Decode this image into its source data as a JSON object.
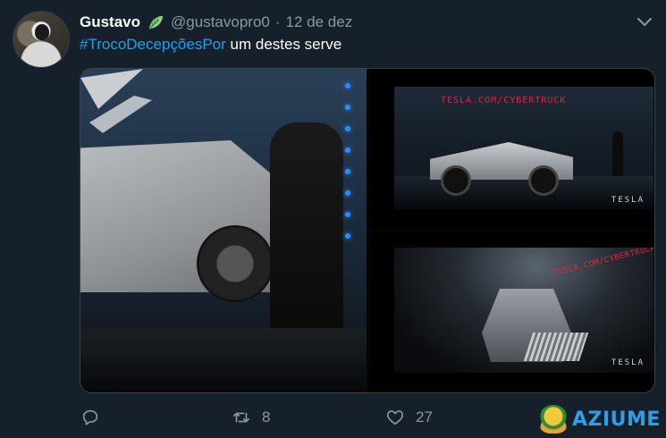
{
  "tweet": {
    "display_name": "Gustavo",
    "handle": "@gustavopro0",
    "separator": "·",
    "date": "12 de dez",
    "hashtag": "#TrocoDecepçõesPor",
    "text_after": " um destes serve"
  },
  "media": {
    "right_top_url": "TESLA.COM/CYBERTRUCK",
    "right_top_logo": "TESLA",
    "right_bottom_url": "TESLA.COM/CYBERTRUCK",
    "right_bottom_logo": "TESLA"
  },
  "actions": {
    "reply_icon": "reply-icon",
    "retweet_icon": "retweet-icon",
    "retweet_count": "8",
    "like_icon": "heart-icon",
    "like_count": "27"
  },
  "watermark": {
    "brand": "AZIUME"
  },
  "colors": {
    "background": "#15202b",
    "link": "#1da1f2",
    "muted": "#8899a6",
    "tesla_red": "#e0263a",
    "watermark_blue": "#2d9fe8"
  }
}
